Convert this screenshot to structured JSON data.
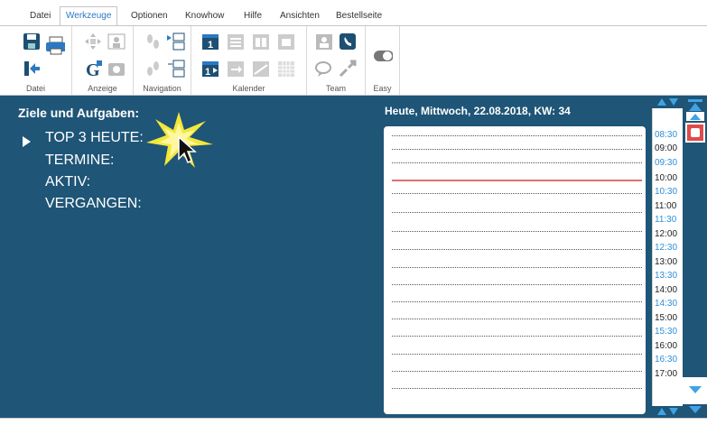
{
  "tabs": [
    {
      "label": "Datei"
    },
    {
      "label": "Werkzeuge",
      "active": true
    },
    {
      "label": "Optionen"
    },
    {
      "label": "Knowhow"
    },
    {
      "label": "Hilfe"
    },
    {
      "label": "Ansichten"
    },
    {
      "label": "Bestellseite"
    }
  ],
  "groups": {
    "datei": "Datei",
    "anzeige": "Anzeige",
    "navigation": "Navigation",
    "kalender": "Kalender",
    "team": "Team",
    "easy": "Easy"
  },
  "panel": {
    "title": "Ziele und Aufgaben:",
    "items": [
      "TOP 3 HEUTE:",
      "TERMINE:",
      "AKTIV:",
      "VERGANGEN:"
    ]
  },
  "calendar": {
    "date_title": "Heute, Mittwoch, 22.08.2018, KW: 34",
    "times": [
      "08:30",
      "09:00",
      "09:30",
      "10:00",
      "10:30",
      "11:00",
      "11:30",
      "12:00",
      "12:30",
      "13:00",
      "13:30",
      "14:00",
      "14:30",
      "15:00",
      "15:30",
      "16:00",
      "16:30",
      "17:00"
    ]
  },
  "colors": {
    "panel_bg": "#1f5577",
    "accent": "#2b79c2",
    "half_hour": "#2b8fd8",
    "current_time_line": "#e07070"
  },
  "icons": {
    "save": "save-icon",
    "print": "print-icon",
    "exit": "exit-icon",
    "google": "google-icon",
    "cursor": "mouse-cursor-icon"
  }
}
